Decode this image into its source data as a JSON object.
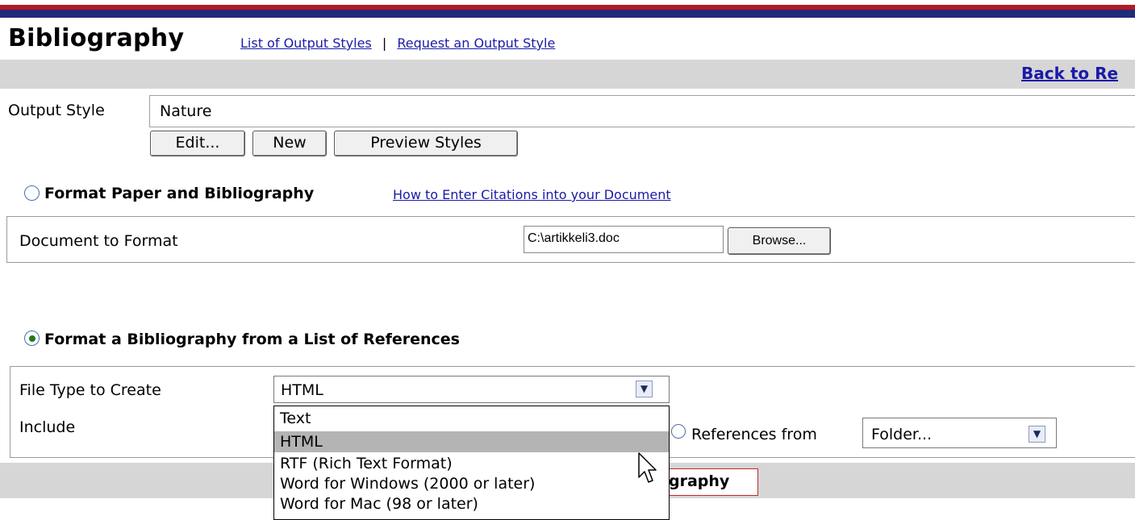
{
  "page": {
    "title": "Bibliography",
    "links": [
      "List of Output Styles",
      "Request an Output Style"
    ],
    "link_separator": "|",
    "back_link": "Back to Re"
  },
  "output_style": {
    "label": "Output Style",
    "value": "Nature",
    "buttons": {
      "edit": "Edit...",
      "new": "New",
      "preview": "Preview Styles"
    }
  },
  "format_paper": {
    "heading": "Format Paper and Bibliography",
    "help_link": "How to Enter Citations into your Document",
    "selected": false,
    "document_label": "Document to Format",
    "document_value": "C:\\artikkeli3.doc",
    "browse_label": "Browse..."
  },
  "format_list": {
    "heading": "Format a Bibliography from a List of References",
    "selected": true,
    "file_type_label": "File Type to Create",
    "file_type_value": "HTML",
    "include_label": "Include",
    "references_from_label": "References from",
    "references_from_value": "Folder..."
  },
  "file_type_options": [
    "Text",
    "HTML",
    "RTF (Rich Text Format)",
    "Word for Windows (2000 or later)",
    "Word for Mac (98 or later)"
  ],
  "file_type_selected_index": 1,
  "submit_label_visible": "graphy",
  "colors": {
    "top_stripe_red": "#b21a24",
    "top_stripe_blue": "#202b7a",
    "link_blue": "#1a1aa8",
    "band_grey": "#d6d6d6",
    "selected_option": "#b4b4b4",
    "submit_border": "#c02a2a"
  },
  "icons": {
    "dropdown_arrow": "chevron-down-icon",
    "cursor": "mouse-pointer-icon",
    "radio": "radio-icon"
  }
}
